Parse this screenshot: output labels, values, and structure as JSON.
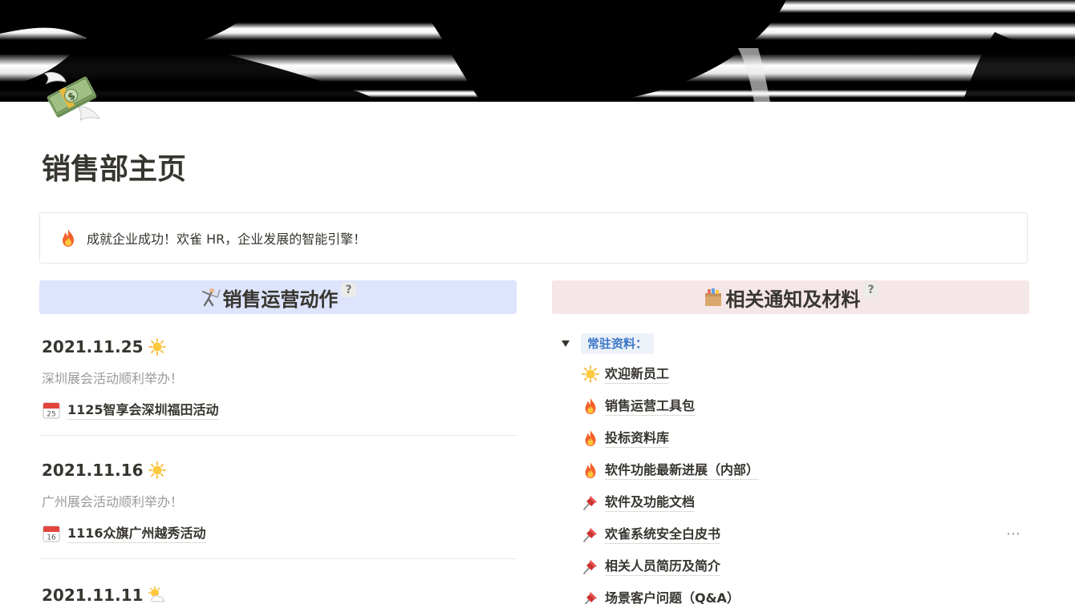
{
  "page": {
    "title": "销售部主页",
    "cover_icon": "flying-money-icon"
  },
  "callout": {
    "icon": "fire-icon",
    "text": "成就企业成功！欢雀 HR，企业发展的智能引擎！"
  },
  "left_column": {
    "header": "销售运营动作",
    "header_icon": "fencer-icon",
    "help": "?",
    "bg_color": "#dde4fc",
    "events": [
      {
        "date": "2021.11.25",
        "weather_icon": "sun-icon",
        "desc": "深圳展会活动顺利举办！",
        "link": "1125智享会深圳福田活动",
        "calendar_day": "25"
      },
      {
        "date": "2021.11.16",
        "weather_icon": "sun-icon",
        "desc": "广州展会活动顺利举办！",
        "link": "1116众旗广州越秀活动",
        "calendar_day": "16"
      },
      {
        "date": "2021.11.11",
        "weather_icon": "sun-behind-cloud-icon"
      }
    ]
  },
  "right_column": {
    "header": "相关通知及材料",
    "header_icon": "package-icon",
    "help": "?",
    "bg_color": "#f5e6e8",
    "toggle": {
      "label": "常驻资料：",
      "expanded": true
    },
    "items": [
      {
        "icon": "sun-icon",
        "label": "欢迎新员工"
      },
      {
        "icon": "fire-icon",
        "label": "销售运营工具包"
      },
      {
        "icon": "fire-icon",
        "label": "投标资料库"
      },
      {
        "icon": "fire-icon",
        "label": "软件功能最新进展（内部）"
      },
      {
        "icon": "pushpin-icon",
        "label": "软件及功能文档"
      },
      {
        "icon": "pushpin-icon",
        "label": "欢雀系统安全白皮书"
      },
      {
        "icon": "pushpin-icon",
        "label": "相关人员简历及简介"
      },
      {
        "icon": "pushpin-icon",
        "label": "场景客户问题（Q&A）"
      }
    ],
    "more_menu": "⋯"
  }
}
